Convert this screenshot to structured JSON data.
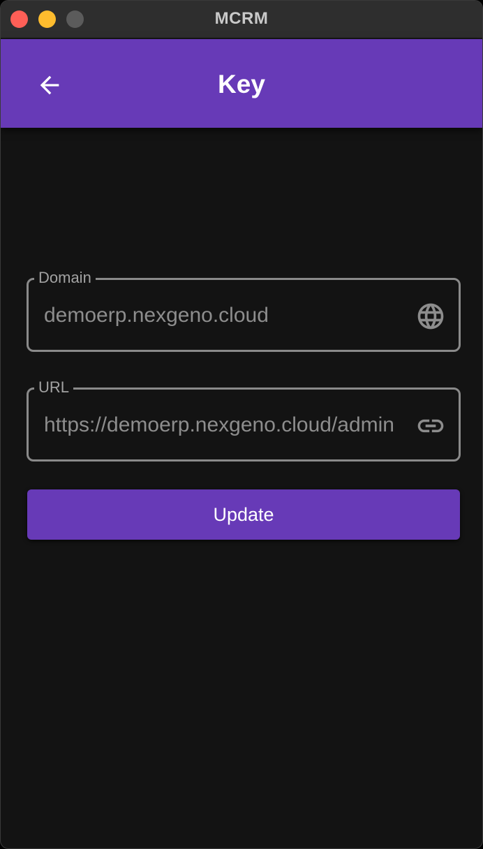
{
  "window": {
    "title": "MCRM"
  },
  "appbar": {
    "title": "Key",
    "back_icon": "arrow-left-icon"
  },
  "form": {
    "domain": {
      "label": "Domain",
      "value": "demoerp.nexgeno.cloud",
      "icon": "globe-icon"
    },
    "url": {
      "label": "URL",
      "value": "https://demoerp.nexgeno.cloud/admin",
      "icon": "link-icon"
    },
    "update_label": "Update"
  },
  "colors": {
    "accent": "#673ab7",
    "background": "#131313",
    "field_border": "#8a8a8a",
    "field_text": "#8d8d8d"
  }
}
